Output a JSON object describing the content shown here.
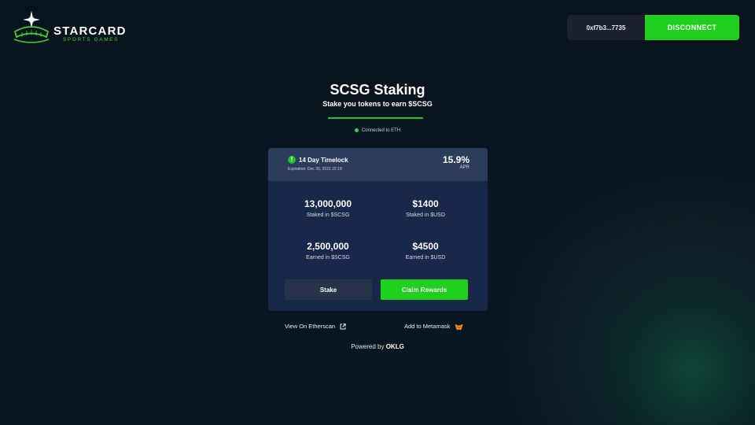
{
  "header": {
    "logo_title": "STARCARD",
    "logo_subtitle": "SPORTS GAMES",
    "wallet_address": "0xf7b3...7735",
    "disconnect_label": "DISCONNECT"
  },
  "main": {
    "title": "SCSG Staking",
    "subtitle": "Stake you tokens to earn $SCSG",
    "connection_status": "Connected to ETH"
  },
  "card": {
    "timelock": "14 Day Timelock",
    "expiration": "Expiration: Dec 30, 2021 22:19",
    "apr_value": "15.9%",
    "apr_label": "APR",
    "stats": [
      {
        "value": "13,000,000",
        "label": "Staked in $SCSG"
      },
      {
        "value": "$1400",
        "label": "Staked in $USD"
      },
      {
        "value": "2,500,000",
        "label": "Earned in $SCSG"
      },
      {
        "value": "$4500",
        "label": "Earned in $USD"
      }
    ],
    "stake_label": "Stake",
    "claim_label": "Claim Rewards"
  },
  "footer": {
    "etherscan_label": "View On Etherscan",
    "metamask_label": "Add to Metamask",
    "powered_prefix": "Powered by",
    "powered_brand": "OKLG"
  },
  "colors": {
    "accent_green": "#1fd01f",
    "card_bg": "#17284a",
    "card_header": "#2c3d5c",
    "page_bg": "#0a1722"
  },
  "icons": [
    "sparkle-star-icon",
    "stadium-icon",
    "info-icon",
    "external-link-icon",
    "metamask-fox-icon"
  ]
}
